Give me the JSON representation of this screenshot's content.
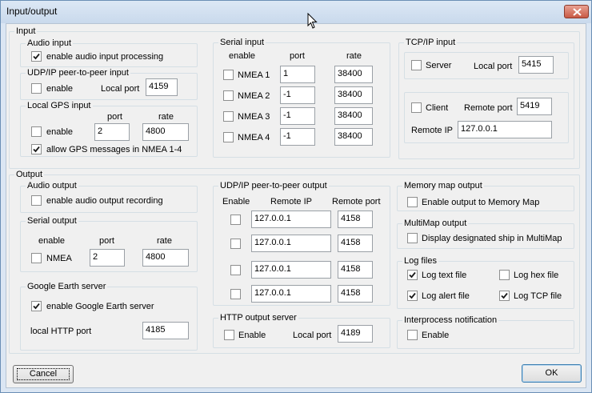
{
  "window": {
    "title": "Input/output"
  },
  "input": {
    "label": "Input",
    "audio": {
      "label": "Audio input",
      "enable_label": "enable audio input processing",
      "enabled": true
    },
    "udp": {
      "label": "UDP/IP peer-to-peer input",
      "enable_label": "enable",
      "enabled": false,
      "port_label": "Local port",
      "port": "4159"
    },
    "gps": {
      "label": "Local GPS input",
      "port_header": "port",
      "rate_header": "rate",
      "enable_label": "enable",
      "enabled": false,
      "port": "2",
      "rate": "4800",
      "allow_label": "allow GPS messages in NMEA 1-4",
      "allow": true
    },
    "serial": {
      "label": "Serial input",
      "enable_header": "enable",
      "port_header": "port",
      "rate_header": "rate",
      "rows": [
        {
          "name": "NMEA 1",
          "enabled": false,
          "port": "1",
          "rate": "38400"
        },
        {
          "name": "NMEA 2",
          "enabled": false,
          "port": "-1",
          "rate": "38400"
        },
        {
          "name": "NMEA 3",
          "enabled": false,
          "port": "-1",
          "rate": "38400"
        },
        {
          "name": "NMEA 4",
          "enabled": false,
          "port": "-1",
          "rate": "38400"
        }
      ]
    },
    "tcp": {
      "label": "TCP/IP input",
      "server_label": "Server",
      "server": false,
      "local_port_label": "Local port",
      "local_port": "5415",
      "client_label": "Client",
      "client": false,
      "remote_port_label": "Remote port",
      "remote_port": "5419",
      "remote_ip_label": "Remote IP",
      "remote_ip": "127.0.0.1"
    }
  },
  "output": {
    "label": "Output",
    "audio": {
      "label": "Audio output",
      "enable_label": "enable audio output recording",
      "enabled": false
    },
    "serial": {
      "label": "Serial output",
      "enable_header": "enable",
      "port_header": "port",
      "rate_header": "rate",
      "name": "NMEA",
      "enabled": false,
      "port": "2",
      "rate": "4800"
    },
    "google": {
      "label": "Google Earth server",
      "enable_label": "enable Google Earth server",
      "enabled": true,
      "port_label": "local HTTP port",
      "port": "4185"
    },
    "udp": {
      "label": "UDP/IP peer-to-peer output",
      "enable_header": "Enable",
      "ip_header": "Remote IP",
      "port_header": "Remote port",
      "rows": [
        {
          "enabled": false,
          "ip": "127.0.0.1",
          "port": "4158"
        },
        {
          "enabled": false,
          "ip": "127.0.0.1",
          "port": "4158"
        },
        {
          "enabled": false,
          "ip": "127.0.0.1",
          "port": "4158"
        },
        {
          "enabled": false,
          "ip": "127.0.0.1",
          "port": "4158"
        }
      ]
    },
    "http": {
      "label": "HTTP output server",
      "enable_label": "Enable",
      "enabled": false,
      "port_label": "Local port",
      "port": "4189"
    },
    "memory": {
      "label": "Memory map output",
      "enable_label": "Enable output to Memory Map",
      "enabled": false
    },
    "multimap": {
      "label": "MultiMap output",
      "enable_label": "Display designated ship in MultiMap",
      "enabled": false
    },
    "log": {
      "label": "Log files",
      "text_label": "Log text file",
      "text": true,
      "hex_label": "Log hex file",
      "hex": false,
      "alert_label": "Log alert file",
      "alert": true,
      "tcp_label": "Log TCP file",
      "tcp": true
    },
    "ipc": {
      "label": "Interprocess notification",
      "enable_label": "Enable",
      "enabled": false
    }
  },
  "buttons": {
    "cancel": "Cancel",
    "ok": "OK"
  }
}
